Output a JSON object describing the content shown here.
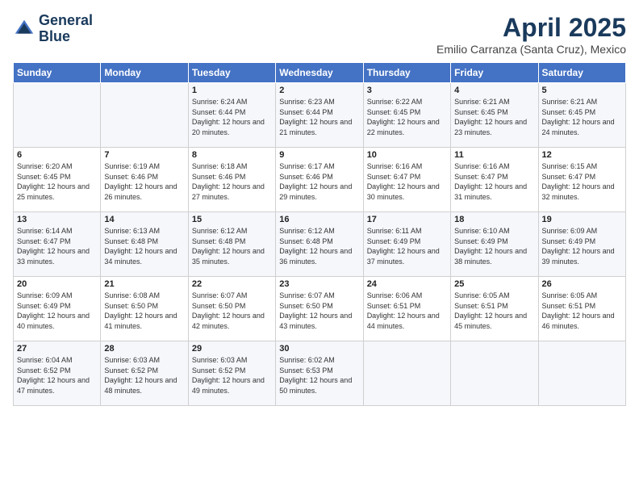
{
  "header": {
    "logo_line1": "General",
    "logo_line2": "Blue",
    "month": "April 2025",
    "location": "Emilio Carranza (Santa Cruz), Mexico"
  },
  "days_of_week": [
    "Sunday",
    "Monday",
    "Tuesday",
    "Wednesday",
    "Thursday",
    "Friday",
    "Saturday"
  ],
  "weeks": [
    [
      {
        "day": "",
        "info": ""
      },
      {
        "day": "",
        "info": ""
      },
      {
        "day": "1",
        "info": "Sunrise: 6:24 AM\nSunset: 6:44 PM\nDaylight: 12 hours and 20 minutes."
      },
      {
        "day": "2",
        "info": "Sunrise: 6:23 AM\nSunset: 6:44 PM\nDaylight: 12 hours and 21 minutes."
      },
      {
        "day": "3",
        "info": "Sunrise: 6:22 AM\nSunset: 6:45 PM\nDaylight: 12 hours and 22 minutes."
      },
      {
        "day": "4",
        "info": "Sunrise: 6:21 AM\nSunset: 6:45 PM\nDaylight: 12 hours and 23 minutes."
      },
      {
        "day": "5",
        "info": "Sunrise: 6:21 AM\nSunset: 6:45 PM\nDaylight: 12 hours and 24 minutes."
      }
    ],
    [
      {
        "day": "6",
        "info": "Sunrise: 6:20 AM\nSunset: 6:45 PM\nDaylight: 12 hours and 25 minutes."
      },
      {
        "day": "7",
        "info": "Sunrise: 6:19 AM\nSunset: 6:46 PM\nDaylight: 12 hours and 26 minutes."
      },
      {
        "day": "8",
        "info": "Sunrise: 6:18 AM\nSunset: 6:46 PM\nDaylight: 12 hours and 27 minutes."
      },
      {
        "day": "9",
        "info": "Sunrise: 6:17 AM\nSunset: 6:46 PM\nDaylight: 12 hours and 29 minutes."
      },
      {
        "day": "10",
        "info": "Sunrise: 6:16 AM\nSunset: 6:47 PM\nDaylight: 12 hours and 30 minutes."
      },
      {
        "day": "11",
        "info": "Sunrise: 6:16 AM\nSunset: 6:47 PM\nDaylight: 12 hours and 31 minutes."
      },
      {
        "day": "12",
        "info": "Sunrise: 6:15 AM\nSunset: 6:47 PM\nDaylight: 12 hours and 32 minutes."
      }
    ],
    [
      {
        "day": "13",
        "info": "Sunrise: 6:14 AM\nSunset: 6:47 PM\nDaylight: 12 hours and 33 minutes."
      },
      {
        "day": "14",
        "info": "Sunrise: 6:13 AM\nSunset: 6:48 PM\nDaylight: 12 hours and 34 minutes."
      },
      {
        "day": "15",
        "info": "Sunrise: 6:12 AM\nSunset: 6:48 PM\nDaylight: 12 hours and 35 minutes."
      },
      {
        "day": "16",
        "info": "Sunrise: 6:12 AM\nSunset: 6:48 PM\nDaylight: 12 hours and 36 minutes."
      },
      {
        "day": "17",
        "info": "Sunrise: 6:11 AM\nSunset: 6:49 PM\nDaylight: 12 hours and 37 minutes."
      },
      {
        "day": "18",
        "info": "Sunrise: 6:10 AM\nSunset: 6:49 PM\nDaylight: 12 hours and 38 minutes."
      },
      {
        "day": "19",
        "info": "Sunrise: 6:09 AM\nSunset: 6:49 PM\nDaylight: 12 hours and 39 minutes."
      }
    ],
    [
      {
        "day": "20",
        "info": "Sunrise: 6:09 AM\nSunset: 6:49 PM\nDaylight: 12 hours and 40 minutes."
      },
      {
        "day": "21",
        "info": "Sunrise: 6:08 AM\nSunset: 6:50 PM\nDaylight: 12 hours and 41 minutes."
      },
      {
        "day": "22",
        "info": "Sunrise: 6:07 AM\nSunset: 6:50 PM\nDaylight: 12 hours and 42 minutes."
      },
      {
        "day": "23",
        "info": "Sunrise: 6:07 AM\nSunset: 6:50 PM\nDaylight: 12 hours and 43 minutes."
      },
      {
        "day": "24",
        "info": "Sunrise: 6:06 AM\nSunset: 6:51 PM\nDaylight: 12 hours and 44 minutes."
      },
      {
        "day": "25",
        "info": "Sunrise: 6:05 AM\nSunset: 6:51 PM\nDaylight: 12 hours and 45 minutes."
      },
      {
        "day": "26",
        "info": "Sunrise: 6:05 AM\nSunset: 6:51 PM\nDaylight: 12 hours and 46 minutes."
      }
    ],
    [
      {
        "day": "27",
        "info": "Sunrise: 6:04 AM\nSunset: 6:52 PM\nDaylight: 12 hours and 47 minutes."
      },
      {
        "day": "28",
        "info": "Sunrise: 6:03 AM\nSunset: 6:52 PM\nDaylight: 12 hours and 48 minutes."
      },
      {
        "day": "29",
        "info": "Sunrise: 6:03 AM\nSunset: 6:52 PM\nDaylight: 12 hours and 49 minutes."
      },
      {
        "day": "30",
        "info": "Sunrise: 6:02 AM\nSunset: 6:53 PM\nDaylight: 12 hours and 50 minutes."
      },
      {
        "day": "",
        "info": ""
      },
      {
        "day": "",
        "info": ""
      },
      {
        "day": "",
        "info": ""
      }
    ]
  ]
}
